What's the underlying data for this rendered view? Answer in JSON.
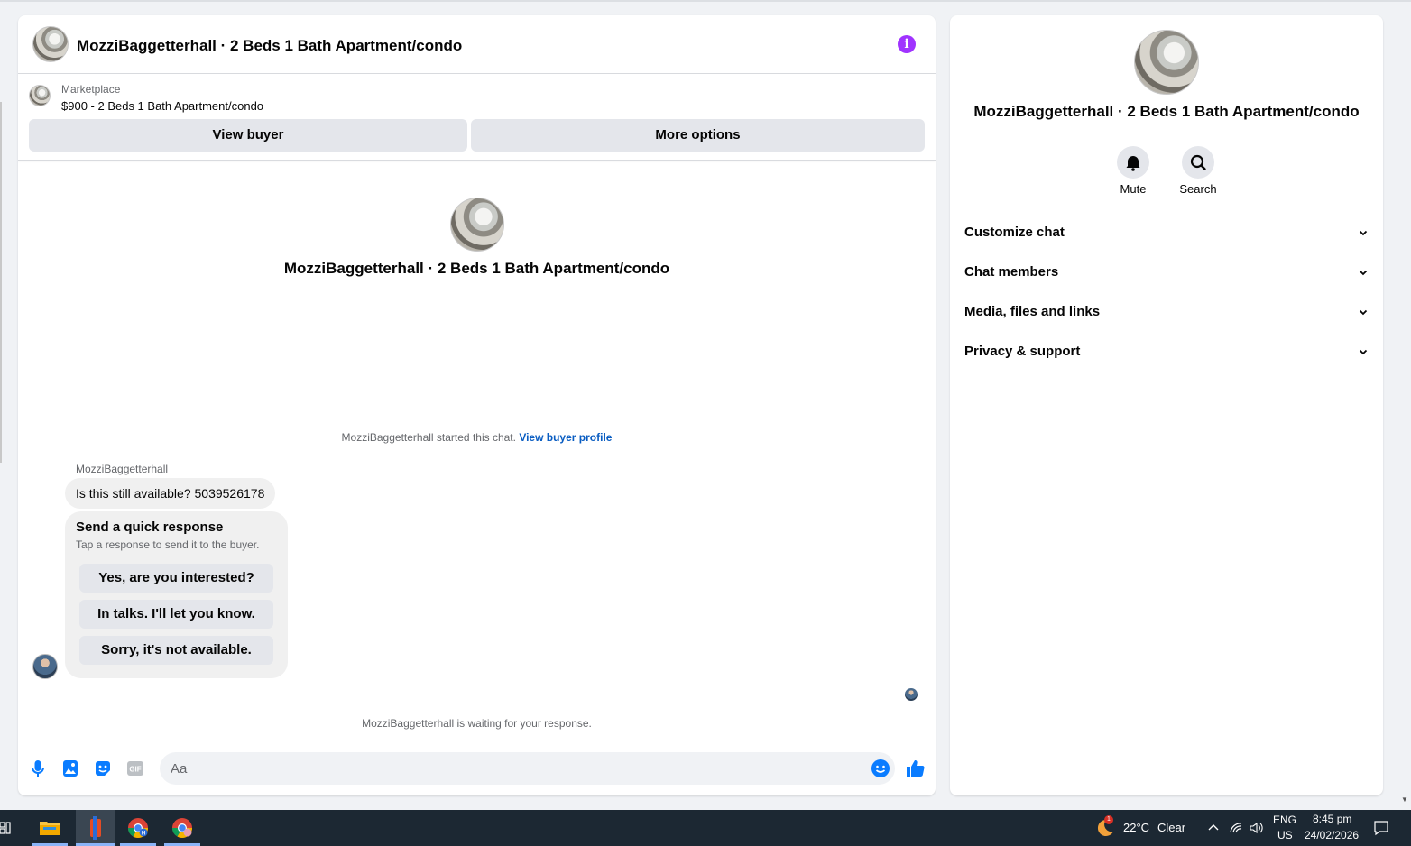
{
  "chat": {
    "title": "MozziBaggetterhall · 2 Beds 1 Bath Apartment/condo",
    "listing": {
      "category": "Marketplace",
      "price_title": "$900 - 2 Beds 1 Bath Apartment/condo"
    },
    "buttons": {
      "view_buyer": "View buyer",
      "more_options": "More options"
    },
    "center_title": "MozziBaggetterhall · 2 Beds 1 Bath Apartment/condo",
    "started_text": "MozziBaggetterhall started this chat.",
    "started_link": "View buyer profile",
    "sender_name": "MozziBaggetterhall",
    "message": "Is this still available? 5039526178",
    "quick_response": {
      "title": "Send a quick response",
      "subtitle": "Tap a response to send it to the buyer.",
      "options": [
        "Yes, are you interested?",
        "In talks. I'll let you know.",
        "Sorry, it's not available."
      ]
    },
    "waiting_text": "MozziBaggetterhall is waiting for your response.",
    "composer": {
      "placeholder": "Aa"
    },
    "info_icon": "i"
  },
  "side_panel": {
    "title": "MozziBaggetterhall · 2 Beds 1 Bath Apartment/condo",
    "actions": [
      "Mute",
      "Search"
    ],
    "sections": [
      "Customize chat",
      "Chat members",
      "Media, files and links",
      "Privacy & support"
    ]
  },
  "taskbar": {
    "weather_temp": "22°C",
    "weather_cond": "Clear",
    "weather_badge": "1",
    "lang_top": "ENG",
    "lang_bottom": "US",
    "time": "8:45 pm",
    "date": "24/02/2026"
  },
  "colors": {
    "accent_blue": "#0a7cff",
    "info_purple": "#a033ff",
    "link_blue": "#0a5dc2",
    "taskbar": "#1c2833"
  }
}
